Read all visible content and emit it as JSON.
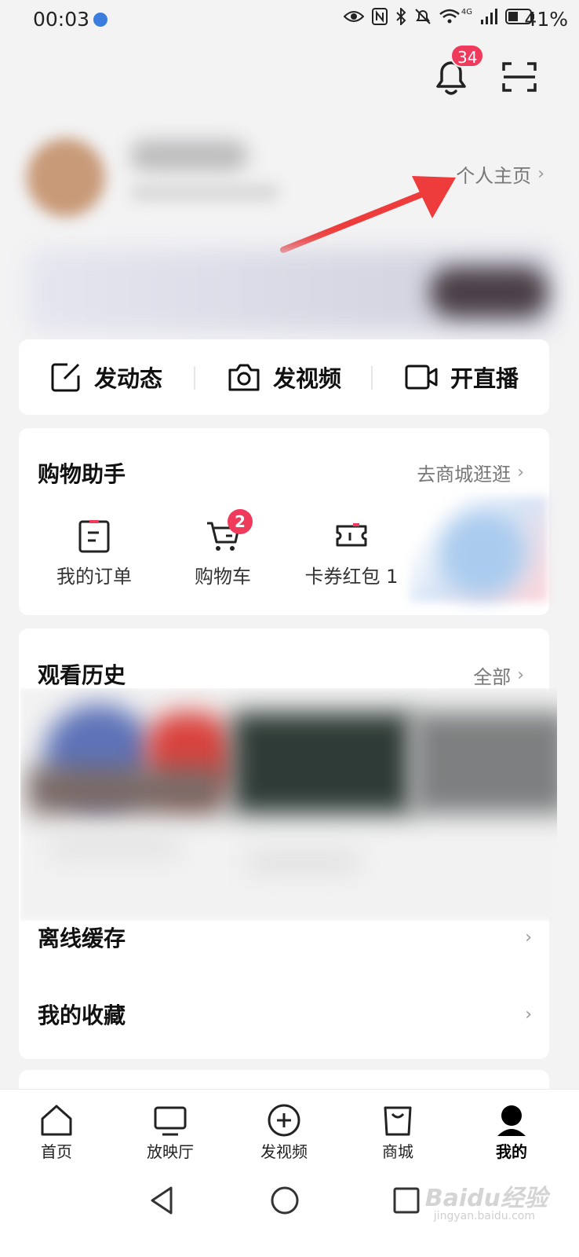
{
  "status_bar": {
    "time": "00:03",
    "battery": "41%",
    "network": "4G"
  },
  "header": {
    "notification_count": "34"
  },
  "profile": {
    "home_link": "个人主页"
  },
  "post_actions": [
    {
      "label": "发动态",
      "icon": "edit-icon"
    },
    {
      "label": "发视频",
      "icon": "camera-icon"
    },
    {
      "label": "开直播",
      "icon": "video-camera-icon"
    }
  ],
  "shopping": {
    "title": "购物助手",
    "link": "去商城逛逛",
    "items": [
      {
        "label": "我的订单",
        "icon": "order-icon"
      },
      {
        "label": "购物车",
        "icon": "cart-icon",
        "badge": "2"
      },
      {
        "label": "卡券红包 1",
        "icon": "coupon-icon"
      }
    ]
  },
  "history": {
    "title": "观看历史",
    "link": "全部"
  },
  "list": [
    {
      "label": "离线缓存"
    },
    {
      "label": "我的收藏"
    }
  ],
  "tabs": [
    {
      "label": "首页",
      "icon": "home-icon"
    },
    {
      "label": "放映厅",
      "icon": "tv-icon"
    },
    {
      "label": "发视频",
      "icon": "plus-circle-icon"
    },
    {
      "label": "商城",
      "icon": "shopping-bag-icon"
    },
    {
      "label": "我的",
      "icon": "user-icon",
      "active": true
    }
  ],
  "watermark": {
    "main": "Baidu经验",
    "sub": "jingyan.baidu.com"
  },
  "colors": {
    "accent_red": "#f03a5c",
    "arrow_red": "#ee3b3b",
    "background": "#f3f3f4"
  }
}
